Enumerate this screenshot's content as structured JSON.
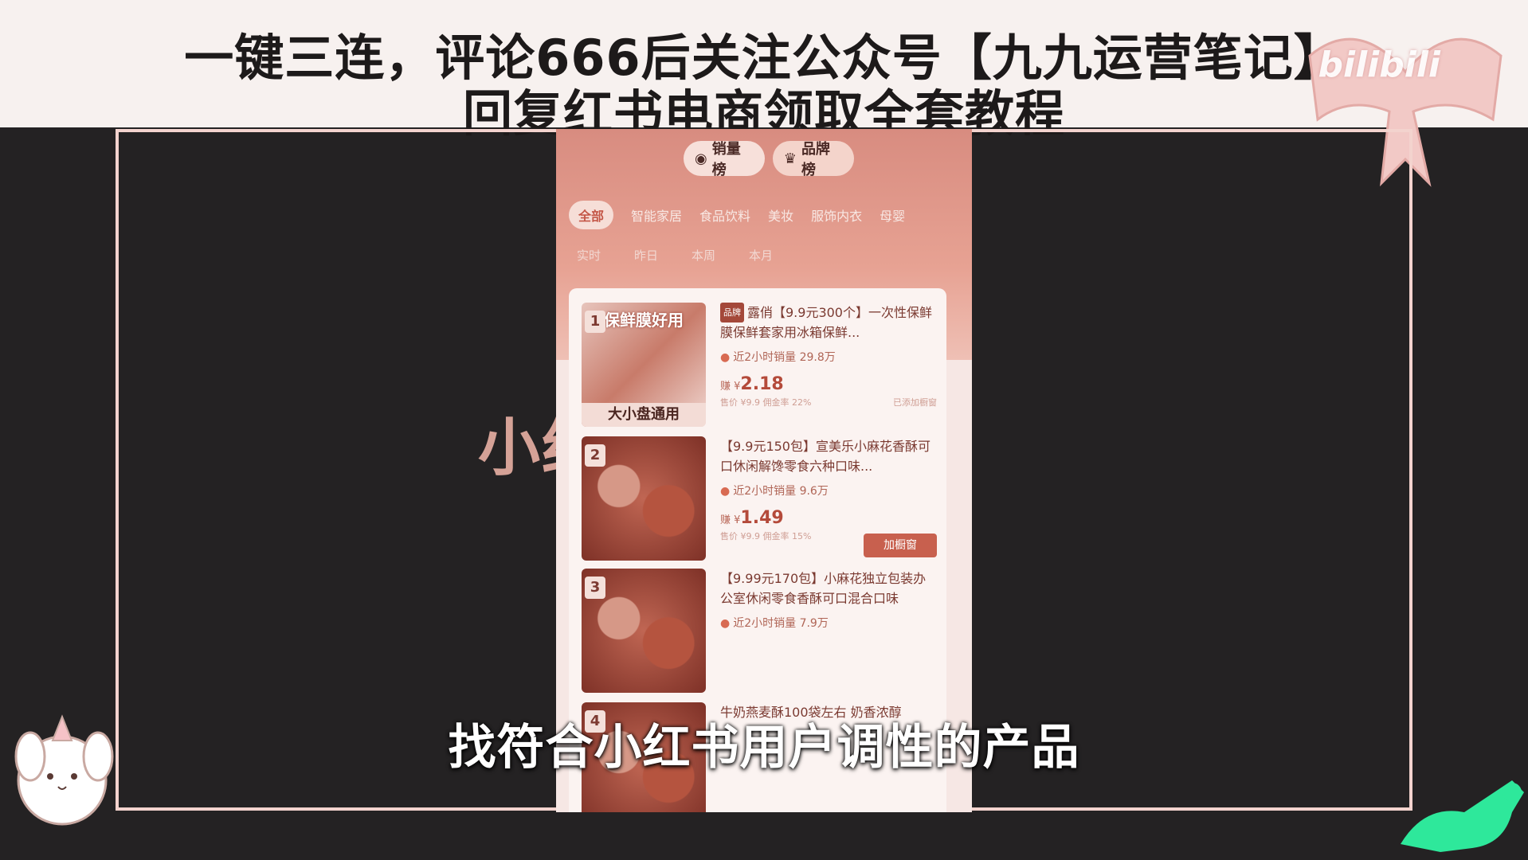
{
  "banner": {
    "line1": "一键三连，评论666后关注公众号【九九运营笔记】",
    "line2": "回复红书电商领取全套教程"
  },
  "watermark": "bilibili",
  "background_text": "小红书选品",
  "phone": {
    "rank_tabs": [
      {
        "label": "销量榜",
        "icon": "trend-icon"
      },
      {
        "label": "品牌榜",
        "icon": "crown-icon"
      }
    ],
    "categories": [
      "全部",
      "智能家居",
      "食品饮料",
      "美妆",
      "服饰内衣",
      "母婴"
    ],
    "active_category": "全部",
    "time_filters": [
      "实时",
      "昨日",
      "本周",
      "本月"
    ],
    "items": [
      {
        "rank": "1",
        "thumb_top": "保鲜膜好用",
        "thumb_bottom": "大小盘通用",
        "tag": "品牌",
        "title": "露俏【9.9元300个】一次性保鲜膜保鲜套家用冰箱保鲜...",
        "sales": "近2小时销量 29.8万",
        "price_prefix": "赚 ¥",
        "price": "2.18",
        "meta_left": "售价 ¥9.9  佣金率 22%",
        "meta_right": "已添加橱窗",
        "button": ""
      },
      {
        "rank": "2",
        "thumb_top": "",
        "thumb_bottom": "",
        "tag": "",
        "title": "【9.9元150包】宣美乐小麻花香酥可口休闲解馋零食六种口味...",
        "sales": "近2小时销量 9.6万",
        "price_prefix": "赚 ¥",
        "price": "1.49",
        "meta_left": "售价 ¥9.9  佣金率 15%",
        "meta_right": "",
        "button": "加橱窗"
      },
      {
        "rank": "3",
        "thumb_top": "",
        "thumb_bottom": "",
        "tag": "",
        "title": "【9.99元170包】小麻花独立包装办公室休闲零食香酥可口混合口味",
        "sales": "近2小时销量 7.9万",
        "price_prefix": "",
        "price": "",
        "meta_left": "",
        "meta_right": "",
        "button": ""
      },
      {
        "rank": "4",
        "thumb_top": "",
        "thumb_bottom": "",
        "tag": "",
        "title": "牛奶燕麦酥100袋左右 奶香浓醇",
        "sales": "",
        "price_prefix": "",
        "price": "",
        "meta_left": "",
        "meta_right": "",
        "button": ""
      }
    ]
  },
  "subtitle": "找符合小红书用户调性的产品"
}
